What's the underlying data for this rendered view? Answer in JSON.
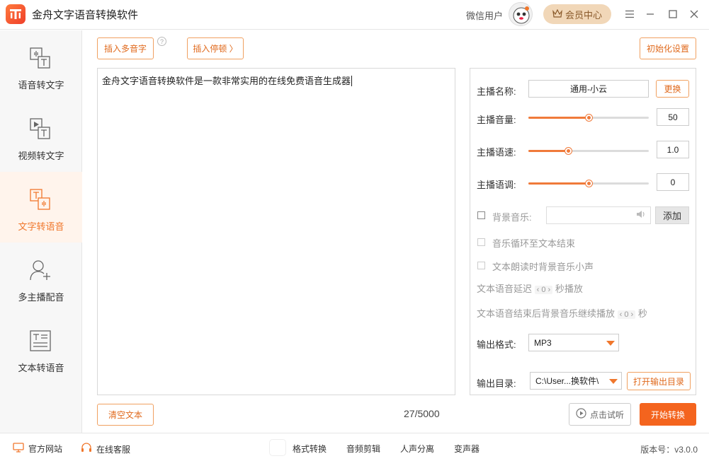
{
  "app": {
    "title": "金舟文字语音转换软件",
    "user_name": "微信用户",
    "vip_label": "会员中心",
    "accent": "#f0772c",
    "start_color": "#f4641e"
  },
  "sidebar": {
    "items": [
      {
        "label": "语音转文字",
        "icon": "audio-to-text-icon"
      },
      {
        "label": "视频转文字",
        "icon": "video-to-text-icon"
      },
      {
        "label": "文字转语音",
        "icon": "text-to-speech-icon",
        "active": true
      },
      {
        "label": "多主播配音",
        "icon": "multi-anchor-icon"
      },
      {
        "label": "文本转语音",
        "icon": "document-to-speech-icon"
      }
    ]
  },
  "toolbar": {
    "insert_polyphone": "插入多音字",
    "insert_pause": "插入停顿 〉",
    "reset": "初始化设置"
  },
  "editor": {
    "text": "金舟文字语音转换软件是一款非常实用的在线免费语音生成器",
    "counter": "27/5000",
    "clear_label": "清空文本"
  },
  "settings": {
    "anchor_label": "主播名称:",
    "anchor_value": "通用-小云",
    "change_label": "更换",
    "volume_label": "主播音量:",
    "volume_value": "50",
    "volume_fraction": 0.5,
    "speed_label": "主播语速:",
    "speed_value": "1.0",
    "speed_fraction": 0.33,
    "pitch_label": "主播语调:",
    "pitch_value": "0",
    "pitch_fraction": 0.5,
    "bgm_label": "背景音乐:",
    "add_label": "添加",
    "loop_label": "音乐循环至文本结束",
    "duck_label": "文本朗读时背景音乐小声",
    "delay_prefix": "文本语音延迟",
    "delay_value": "0",
    "delay_suffix": "秒播放",
    "continue_prefix": "文本语音结束后背景音乐继续播放",
    "continue_value": "0",
    "continue_suffix": "秒",
    "format_label": "输出格式:",
    "format_value": "MP3",
    "dir_label": "输出目录:",
    "dir_value": "C:\\User...换软件\\",
    "open_dir_label": "打开输出目录"
  },
  "actions": {
    "listen_label": "点击试听",
    "start_label": "开始转换"
  },
  "statusbar": {
    "website": "官方网站",
    "support": "在线客服",
    "links": [
      "格式转换",
      "音频剪辑",
      "人声分离",
      "变声器"
    ],
    "version": "版本号：v3.0.0"
  }
}
